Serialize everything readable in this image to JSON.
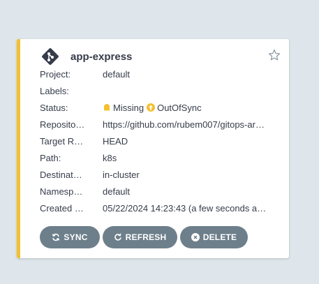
{
  "app": {
    "name": "app-express",
    "icon": "argo-git-icon"
  },
  "fields": {
    "project": {
      "label": "Project:",
      "value": "default"
    },
    "labels": {
      "label": "Labels:",
      "value": ""
    },
    "status": {
      "label": "Status:",
      "health": "Missing",
      "sync": "OutOfSync"
    },
    "repository": {
      "label": "Reposito…",
      "value": "https://github.com/rubem007/gitops-ar…"
    },
    "target_revision": {
      "label": "Target R…",
      "value": "HEAD"
    },
    "path": {
      "label": "Path:",
      "value": "k8s"
    },
    "destination": {
      "label": "Destinat…",
      "value": "in-cluster"
    },
    "namespace": {
      "label": "Namesp…",
      "value": "default"
    },
    "created_at": {
      "label": "Created …",
      "value": "05/22/2024 14:23:43  (a few seconds a…"
    }
  },
  "buttons": {
    "sync": "SYNC",
    "refresh": "REFRESH",
    "delete": "DELETE"
  },
  "colors": {
    "accent_border": "#f4c030",
    "button_bg": "#6d7f8b",
    "status_warning": "#f4c030",
    "status_out_of_sync": "#f4c030",
    "text": "#363c4a"
  }
}
